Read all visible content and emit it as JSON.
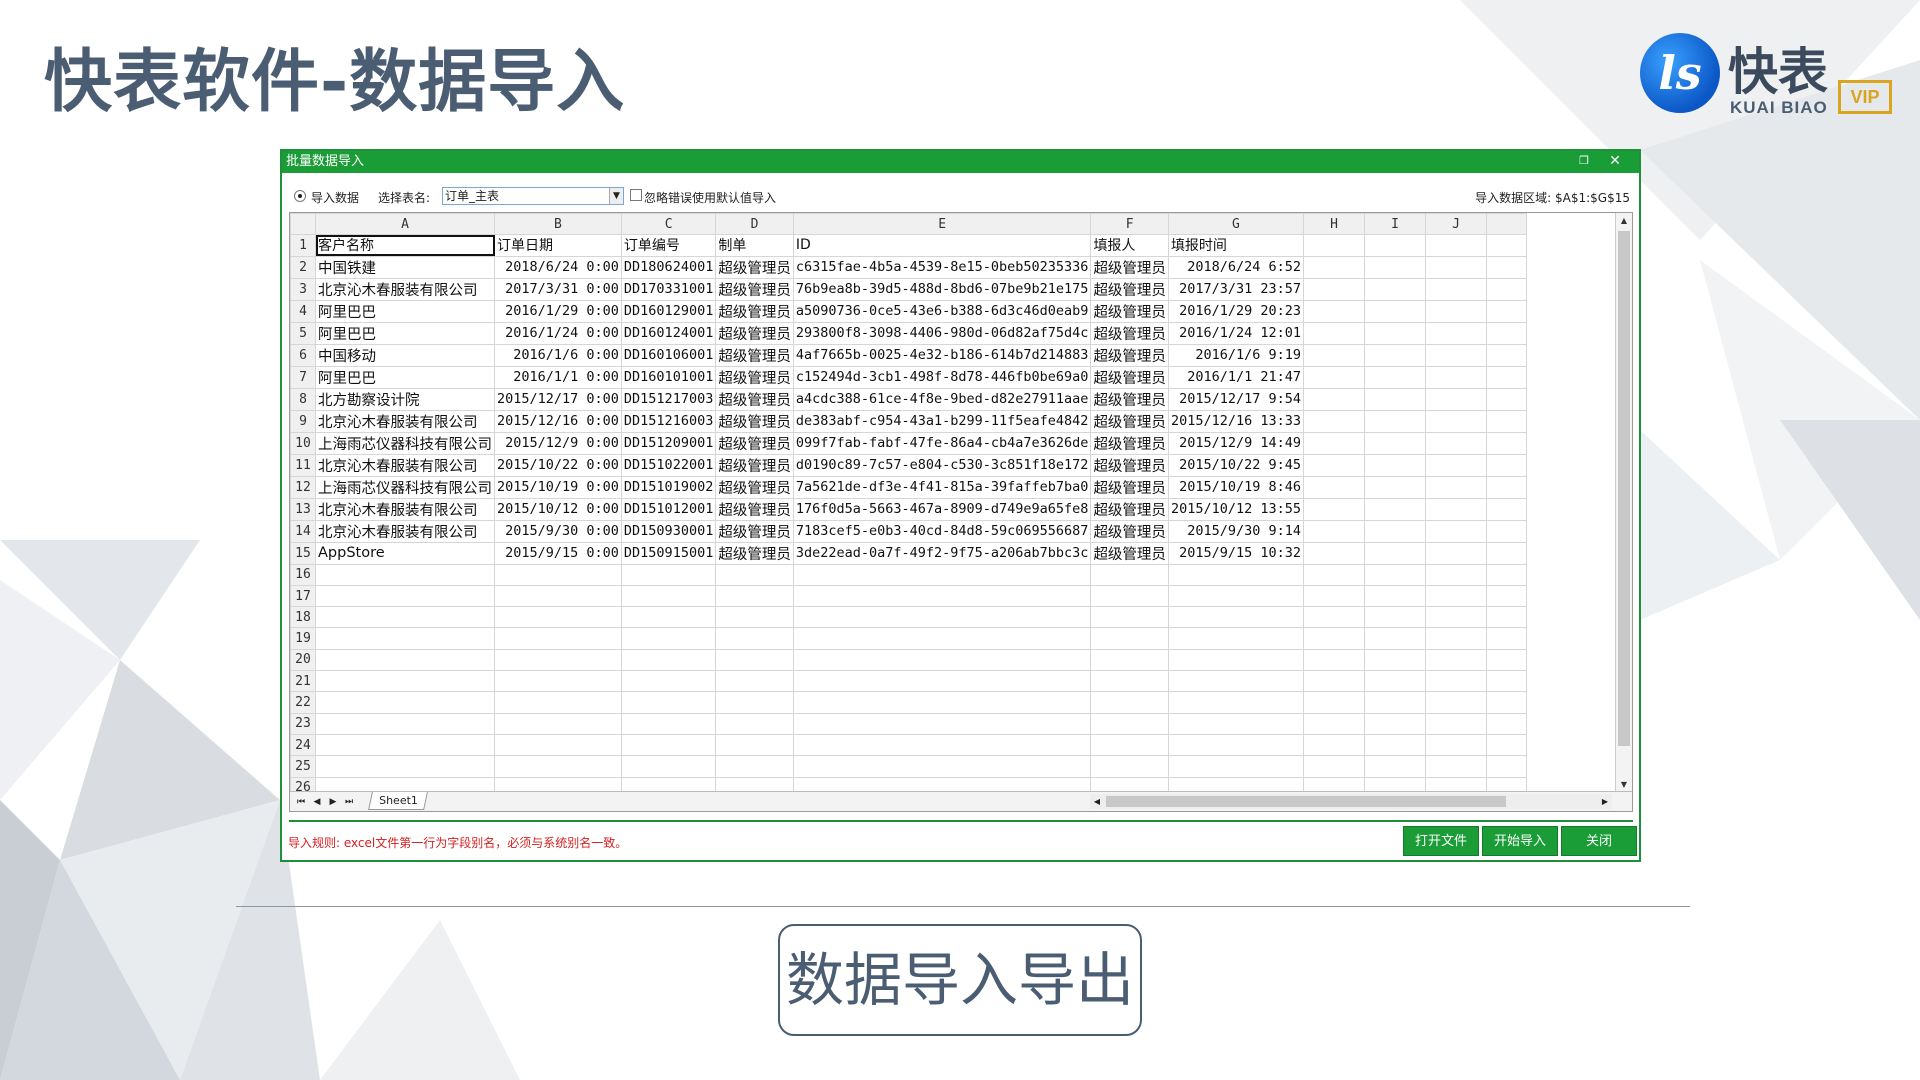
{
  "slide": {
    "title": "快表软件-数据导入",
    "subtitle_box": "数据导入导出"
  },
  "logo": {
    "mark": "ls",
    "name_cn": "快表",
    "name_en": "KUAI BIAO",
    "badge": "VIP"
  },
  "dialog": {
    "title": "批量数据导入",
    "restore_icon": "restore-icon",
    "close_icon": "close-icon",
    "radio_label": "导入数据",
    "select_table_label": "选择表名:",
    "selected_table": "订单_主表",
    "ignore_errors_label": "忽略错误使用默认值导入",
    "ignore_errors_checked": false,
    "import_range_label": "导入数据区域: $A$1:$G$15",
    "rule_text": "导入规则: excel文件第一行为字段别名，必须与系统别名一致。",
    "buttons": {
      "open_file": "打开文件",
      "start_import": "开始导入",
      "close": "关闭"
    },
    "accent_color": "#1a9c36"
  },
  "spreadsheet": {
    "columns": [
      "A",
      "B",
      "C",
      "D",
      "E",
      "F",
      "G",
      "H",
      "I",
      "J"
    ],
    "row_numbers": [
      "1",
      "2",
      "3",
      "4",
      "5",
      "6",
      "7",
      "8",
      "9",
      "10",
      "11",
      "12",
      "13",
      "14",
      "15",
      "16",
      "17",
      "18",
      "19",
      "20",
      "21",
      "22",
      "23",
      "24",
      "25",
      "26"
    ],
    "header_row": [
      "客户名称",
      "订单日期",
      "订单编号",
      "制单",
      "ID",
      "填报人",
      "填报时间",
      "",
      "",
      ""
    ],
    "rows": [
      [
        "中国铁建",
        "2018/6/24 0:00",
        "DD180624001",
        "超级管理员",
        "c6315fae-4b5a-4539-8e15-0beb50235336",
        "超级管理员",
        "2018/6/24 6:52",
        "",
        "",
        ""
      ],
      [
        "北京沁木春服装有限公司",
        "2017/3/31 0:00",
        "DD170331001",
        "超级管理员",
        "76b9ea8b-39d5-488d-8bd6-07be9b21e175",
        "超级管理员",
        "2017/3/31 23:57",
        "",
        "",
        ""
      ],
      [
        "阿里巴巴",
        "2016/1/29 0:00",
        "DD160129001",
        "超级管理员",
        "a5090736-0ce5-43e6-b388-6d3c46d0eab9",
        "超级管理员",
        "2016/1/29 20:23",
        "",
        "",
        ""
      ],
      [
        "阿里巴巴",
        "2016/1/24 0:00",
        "DD160124001",
        "超级管理员",
        "293800f8-3098-4406-980d-06d82af75d4c",
        "超级管理员",
        "2016/1/24 12:01",
        "",
        "",
        ""
      ],
      [
        "中国移动",
        "2016/1/6 0:00",
        "DD160106001",
        "超级管理员",
        "4af7665b-0025-4e32-b186-614b7d214883",
        "超级管理员",
        "2016/1/6 9:19",
        "",
        "",
        ""
      ],
      [
        "阿里巴巴",
        "2016/1/1 0:00",
        "DD160101001",
        "超级管理员",
        "c152494d-3cb1-498f-8d78-446fb0be69a0",
        "超级管理员",
        "2016/1/1 21:47",
        "",
        "",
        ""
      ],
      [
        "北方勘察设计院",
        "2015/12/17 0:00",
        "DD151217003",
        "超级管理员",
        "a4cdc388-61ce-4f8e-9bed-d82e27911aae",
        "超级管理员",
        "2015/12/17 9:54",
        "",
        "",
        ""
      ],
      [
        "北京沁木春服装有限公司",
        "2015/12/16 0:00",
        "DD151216003",
        "超级管理员",
        "de383abf-c954-43a1-b299-11f5eafe4842",
        "超级管理员",
        "2015/12/16 13:33",
        "",
        "",
        ""
      ],
      [
        "上海雨芯仪器科技有限公司",
        "2015/12/9 0:00",
        "DD151209001",
        "超级管理员",
        "099f7fab-fabf-47fe-86a4-cb4a7e3626de",
        "超级管理员",
        "2015/12/9 14:49",
        "",
        "",
        ""
      ],
      [
        "北京沁木春服装有限公司",
        "2015/10/22 0:00",
        "DD151022001",
        "超级管理员",
        "d0190c89-7c57-e804-c530-3c851f18e172",
        "超级管理员",
        "2015/10/22 9:45",
        "",
        "",
        ""
      ],
      [
        "上海雨芯仪器科技有限公司",
        "2015/10/19 0:00",
        "DD151019002",
        "超级管理员",
        "7a5621de-df3e-4f41-815a-39faffeb7ba0",
        "超级管理员",
        "2015/10/19 8:46",
        "",
        "",
        ""
      ],
      [
        "北京沁木春服装有限公司",
        "2015/10/12 0:00",
        "DD151012001",
        "超级管理员",
        "176f0d5a-5663-467a-8909-d749e9a65fe8",
        "超级管理员",
        "2015/10/12 13:55",
        "",
        "",
        ""
      ],
      [
        "北京沁木春服装有限公司",
        "2015/9/30 0:00",
        "DD150930001",
        "超级管理员",
        "7183cef5-e0b3-40cd-84d8-59c069556687",
        "超级管理员",
        "2015/9/30 9:14",
        "",
        "",
        ""
      ],
      [
        "AppStore",
        "2015/9/15 0:00",
        "DD150915001",
        "超级管理员",
        "3de22ead-0a7f-49f2-9f75-a206ab7bbc3c",
        "超级管理员",
        "2015/9/15 10:32",
        "",
        "",
        ""
      ]
    ],
    "sheet_tab": "Sheet1"
  }
}
